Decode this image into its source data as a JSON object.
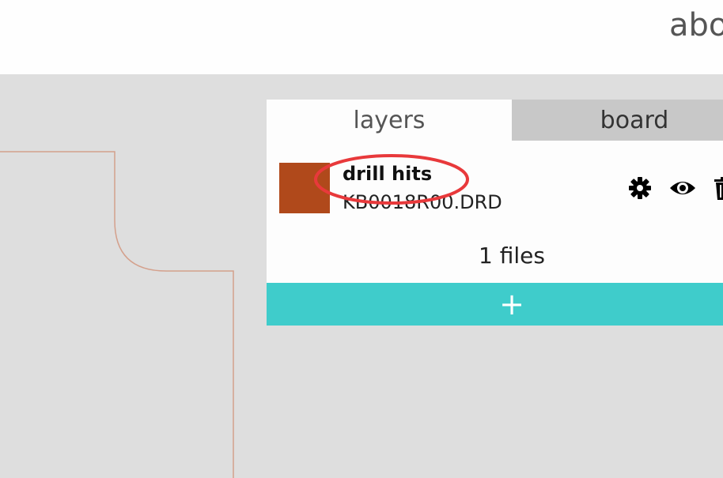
{
  "header": {
    "link_label": "abo"
  },
  "panel": {
    "tabs": [
      {
        "label": "layers",
        "active": true
      },
      {
        "label": "board",
        "active": false
      }
    ],
    "layers": [
      {
        "name": "drill hits",
        "filename": "KB0018R00.DRD",
        "color": "#b0491b",
        "icons": [
          "gear-icon",
          "eye-icon",
          "trash-icon"
        ]
      }
    ],
    "file_count": "1 files",
    "add_label": "+"
  },
  "colors": {
    "accent": "#3fcccb",
    "outline": "#d4a08c",
    "annotation": "#e8393b",
    "layer_swatch": "#b0491b"
  }
}
